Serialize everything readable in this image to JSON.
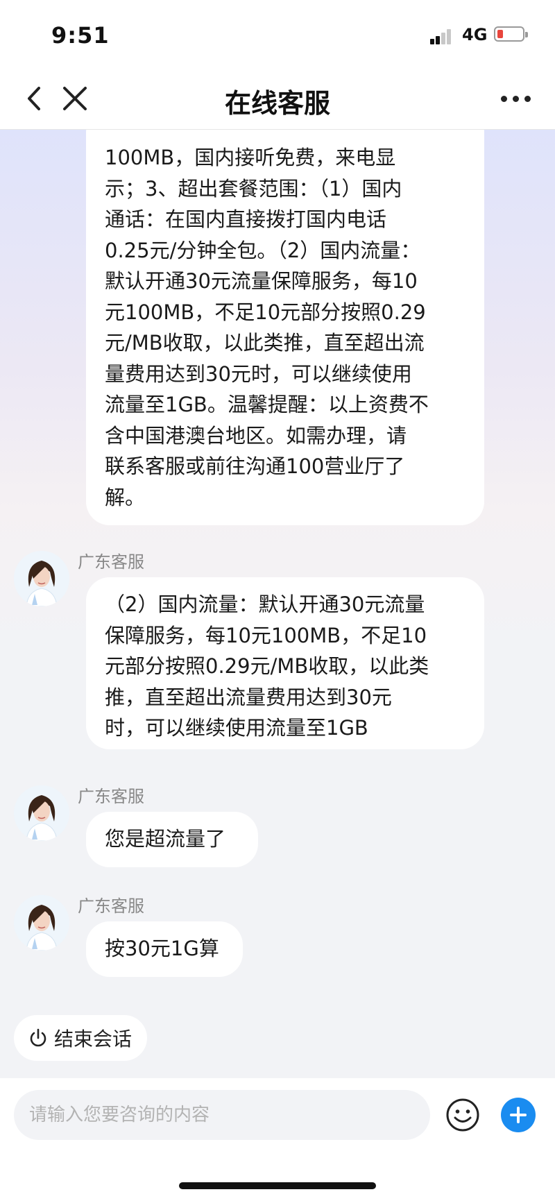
{
  "status_bar": {
    "time": "9:51",
    "network": "4G"
  },
  "nav": {
    "title": "在线客服"
  },
  "messages": [
    {
      "sender": "",
      "text": "100MB，国内接听免费，来电显\n示；3、超出套餐范围：（1）国内\n通话：在国内直接拨打国内电话\n0.25元/分钟全包。（2）国内流量：\n默认开通30元流量保障服务，每10\n元100MB，不足10元部分按照0.29\n元/MB收取，以此类推，直至超出流\n量费用达到30元时，可以继续使用\n流量至1GB。温馨提醒：以上资费不\n含中国港澳台地区。如需办理，请\n联系客服或前往沟通100营业厅了\n解。"
    },
    {
      "sender": "广东客服",
      "text": "（2）国内流量：默认开通30元流量\n保障服务，每10元100MB，不足10\n元部分按照0.29元/MB收取，以此类\n推，直至超出流量费用达到30元\n时，可以继续使用流量至1GB"
    },
    {
      "sender": "广东客服",
      "text": "您是超流量了"
    },
    {
      "sender": "广东客服",
      "text": "按30元1G算"
    }
  ],
  "end_session": {
    "label": "结束会话"
  },
  "input": {
    "placeholder": "请输入您要咨询的内容",
    "value": ""
  },
  "colors": {
    "accent": "#1a8cf0",
    "battery_low": "#e8453c"
  }
}
